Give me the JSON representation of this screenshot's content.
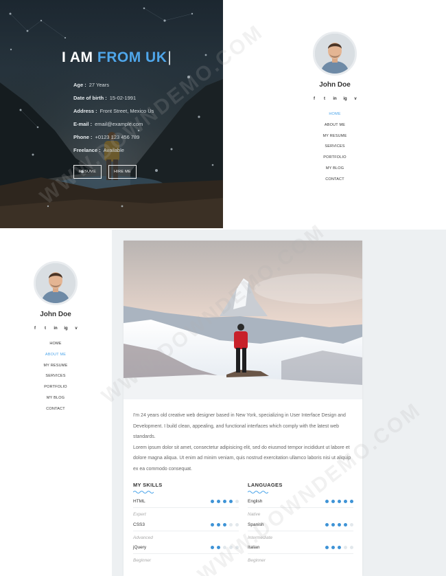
{
  "hero": {
    "title_prefix": "I AM",
    "title_highlight": "FROM UK",
    "cursor": "|",
    "info": [
      {
        "key": "Age :",
        "value": "27 Years"
      },
      {
        "key": "Date of birth :",
        "value": "15-02-1991"
      },
      {
        "key": "Address :",
        "value": "Front Street, Mexico Us"
      },
      {
        "key": "E-mail :",
        "value": "email@example.com"
      },
      {
        "key": "Phone :",
        "value": "+0123 123 456 789"
      },
      {
        "key": "Freelance :",
        "value": "Available"
      }
    ],
    "resume_button": "RESUME",
    "hire_button": "HIRE ME"
  },
  "sidebar_top": {
    "name": "John Doe",
    "socials": [
      "f",
      "t",
      "in",
      "ig",
      "v"
    ],
    "menu": [
      "HOME",
      "ABOUT ME",
      "MY RESUME",
      "SERVICES",
      "PORTFOLIO",
      "MY BLOG",
      "CONTACT"
    ],
    "active": "HOME"
  },
  "sidebar_bottom": {
    "name": "John Doe",
    "socials": [
      "f",
      "t",
      "in",
      "ig",
      "v"
    ],
    "menu": [
      "HOME",
      "ABOUT ME",
      "MY RESUME",
      "SERVICES",
      "PORTFOLIO",
      "MY BLOG",
      "CONTACT"
    ],
    "active": "ABOUT ME"
  },
  "about": {
    "paragraph1": "I'm 24 years old creative web designer based in New York, specializing in User Interface Design and Development. I build clean, appealing, and functional interfaces which comply with the latest web standards.",
    "paragraph2": "Lorem ipsum dolor sit amet, consectetur adipisicing elit, sed do eiusmod tempor incididunt ut labore et dolore magna aliqua. Ut enim ad minim veniam, quis nostrud exercitation ullamco laboris nisi ut aliquip ex ea commodo consequat."
  },
  "skills": {
    "title": "MY SKILLS",
    "items": [
      {
        "name": "HTML",
        "level": "Expert",
        "rating": 4
      },
      {
        "name": "CSS3",
        "level": "Advanced",
        "rating": 3
      },
      {
        "name": "jQuery",
        "level": "Beginner",
        "rating": 2
      }
    ]
  },
  "languages": {
    "title": "LANGUAGES",
    "items": [
      {
        "name": "English",
        "level": "Native",
        "rating": 5
      },
      {
        "name": "Spanish",
        "level": "Intermediate",
        "rating": 4
      },
      {
        "name": "Italian",
        "level": "Beginner",
        "rating": 3
      }
    ]
  },
  "watermark": "WWW.DOWNDEMO.COM",
  "colors": {
    "accent": "#4fa6ea",
    "dot_on": "#3e93d6",
    "dot_off": "#e2e8ec",
    "page_bg": "#edf0f2"
  },
  "icons": {
    "social": [
      "facebook-icon",
      "twitter-icon",
      "linkedin-icon",
      "instagram-icon",
      "vimeo-icon"
    ]
  }
}
